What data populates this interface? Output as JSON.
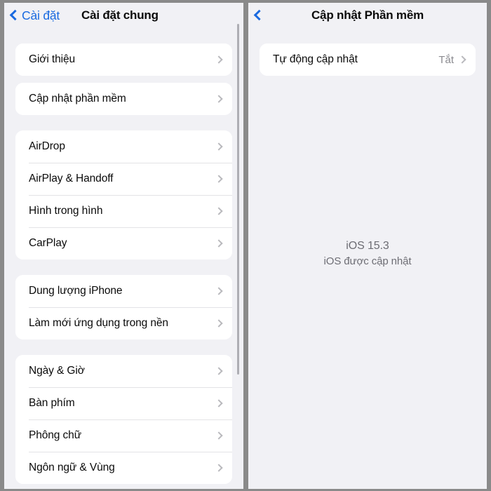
{
  "colors": {
    "accent_blue": "#1a6ae0",
    "highlight_red": "#e02020",
    "page_background": "#f1f1f5",
    "card_background": "#ffffff",
    "frame_gray": "#8a8a8a",
    "secondary_text": "#8b8b90"
  },
  "left_panel": {
    "nav": {
      "back_label": "Cài đặt",
      "back_icon": "chevron-left-icon",
      "title": "Cài đặt chung"
    },
    "sections": [
      {
        "id": "about-section",
        "rows": [
          {
            "label": "Giới thiệu",
            "value": "",
            "accessory": "chevron-right-icon",
            "highlighted": false
          }
        ]
      },
      {
        "id": "software-update-section",
        "highlighted": true,
        "rows": [
          {
            "label": "Cập nhật phần mềm",
            "value": "",
            "accessory": "chevron-right-icon",
            "highlighted": true
          }
        ]
      },
      {
        "id": "connectivity-section",
        "rows": [
          {
            "label": "AirDrop",
            "value": "",
            "accessory": "chevron-right-icon",
            "highlighted": false
          },
          {
            "label": "AirPlay & Handoff",
            "value": "",
            "accessory": "chevron-right-icon",
            "highlighted": false
          },
          {
            "label": "Hình trong hình",
            "value": "",
            "accessory": "chevron-right-icon",
            "highlighted": false
          },
          {
            "label": "CarPlay",
            "value": "",
            "accessory": "chevron-right-icon",
            "highlighted": false
          }
        ]
      },
      {
        "id": "storage-section",
        "rows": [
          {
            "label": "Dung lượng iPhone",
            "value": "",
            "accessory": "chevron-right-icon",
            "highlighted": false
          },
          {
            "label": "Làm mới ứng dụng trong nền",
            "value": "",
            "accessory": "chevron-right-icon",
            "highlighted": false
          }
        ]
      },
      {
        "id": "localization-section",
        "rows": [
          {
            "label": "Ngày & Giờ",
            "value": "",
            "accessory": "chevron-right-icon",
            "highlighted": false
          },
          {
            "label": "Bàn phím",
            "value": "",
            "accessory": "chevron-right-icon",
            "highlighted": false
          },
          {
            "label": "Phông chữ",
            "value": "",
            "accessory": "chevron-right-icon",
            "highlighted": false
          },
          {
            "label": "Ngôn ngữ & Vùng",
            "value": "",
            "accessory": "chevron-right-icon",
            "highlighted": false
          }
        ]
      }
    ]
  },
  "right_panel": {
    "nav": {
      "back_label": "",
      "back_icon": "chevron-left-icon",
      "title": "Cập nhật Phần mềm"
    },
    "rows": [
      {
        "label": "Tự động cập nhật",
        "value": "Tắt",
        "accessory": "chevron-right-icon"
      }
    ],
    "status": {
      "version": "iOS 15.3",
      "message": "iOS được cập nhật"
    }
  }
}
